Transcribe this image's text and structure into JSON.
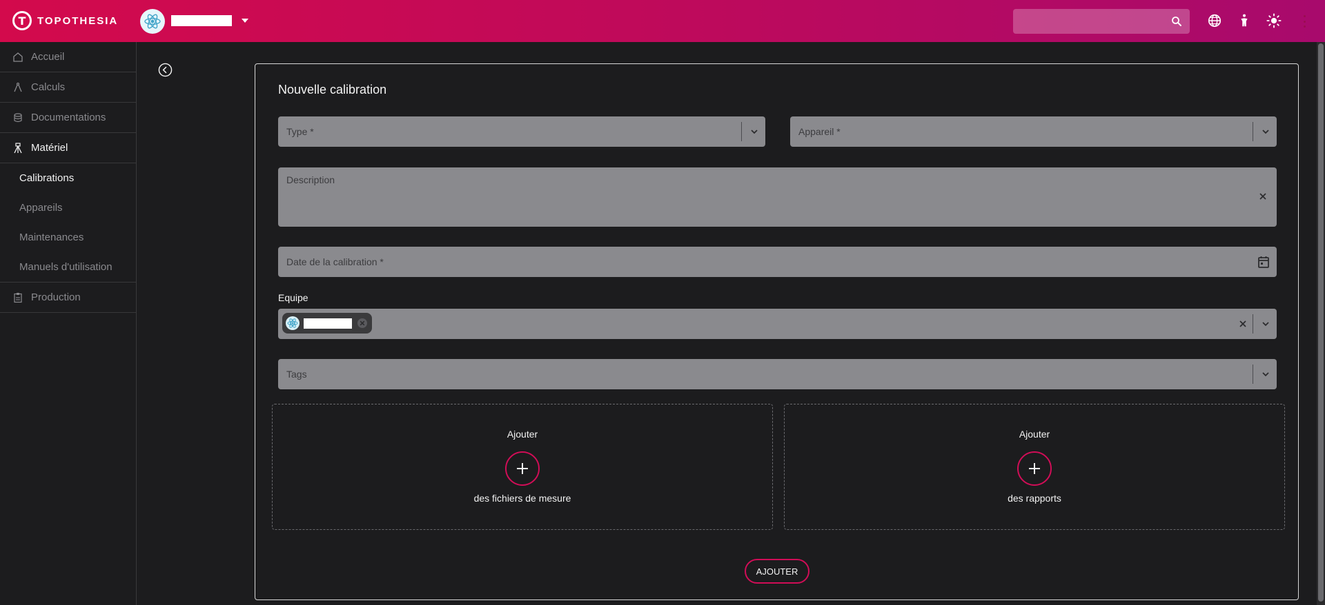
{
  "app": {
    "brand": "TOPOTHESIA"
  },
  "header": {
    "search": {
      "placeholder": ""
    }
  },
  "sidebar": {
    "items": [
      {
        "label": "Accueil",
        "icon": "home-icon"
      },
      {
        "label": "Calculs",
        "icon": "compass-icon"
      },
      {
        "label": "Documentations",
        "icon": "stack-icon"
      },
      {
        "label": "Matériel",
        "icon": "tripod-icon"
      },
      {
        "label": "Production",
        "icon": "clipboard-icon"
      }
    ],
    "sub_items": [
      {
        "label": "Calibrations"
      },
      {
        "label": "Appareils"
      },
      {
        "label": "Maintenances"
      },
      {
        "label": "Manuels d'utilisation"
      }
    ]
  },
  "form": {
    "title": "Nouvelle calibration",
    "type_placeholder": "Type *",
    "device_placeholder": "Appareil *",
    "description_placeholder": "Description",
    "date_placeholder": "Date de la calibration *",
    "team_label": "Equipe",
    "tags_placeholder": "Tags",
    "measure_files": {
      "top": "Ajouter",
      "bottom": "des fichiers de mesure"
    },
    "reports": {
      "top": "Ajouter",
      "bottom": "des rapports"
    },
    "submit_label": "AJOUTER"
  },
  "colors": {
    "accent": "#d10d57",
    "header_start": "#d30a4c",
    "header_end": "#a80a6c",
    "field_bg": "#8a8a8e",
    "page_bg": "#1c1c1e"
  }
}
